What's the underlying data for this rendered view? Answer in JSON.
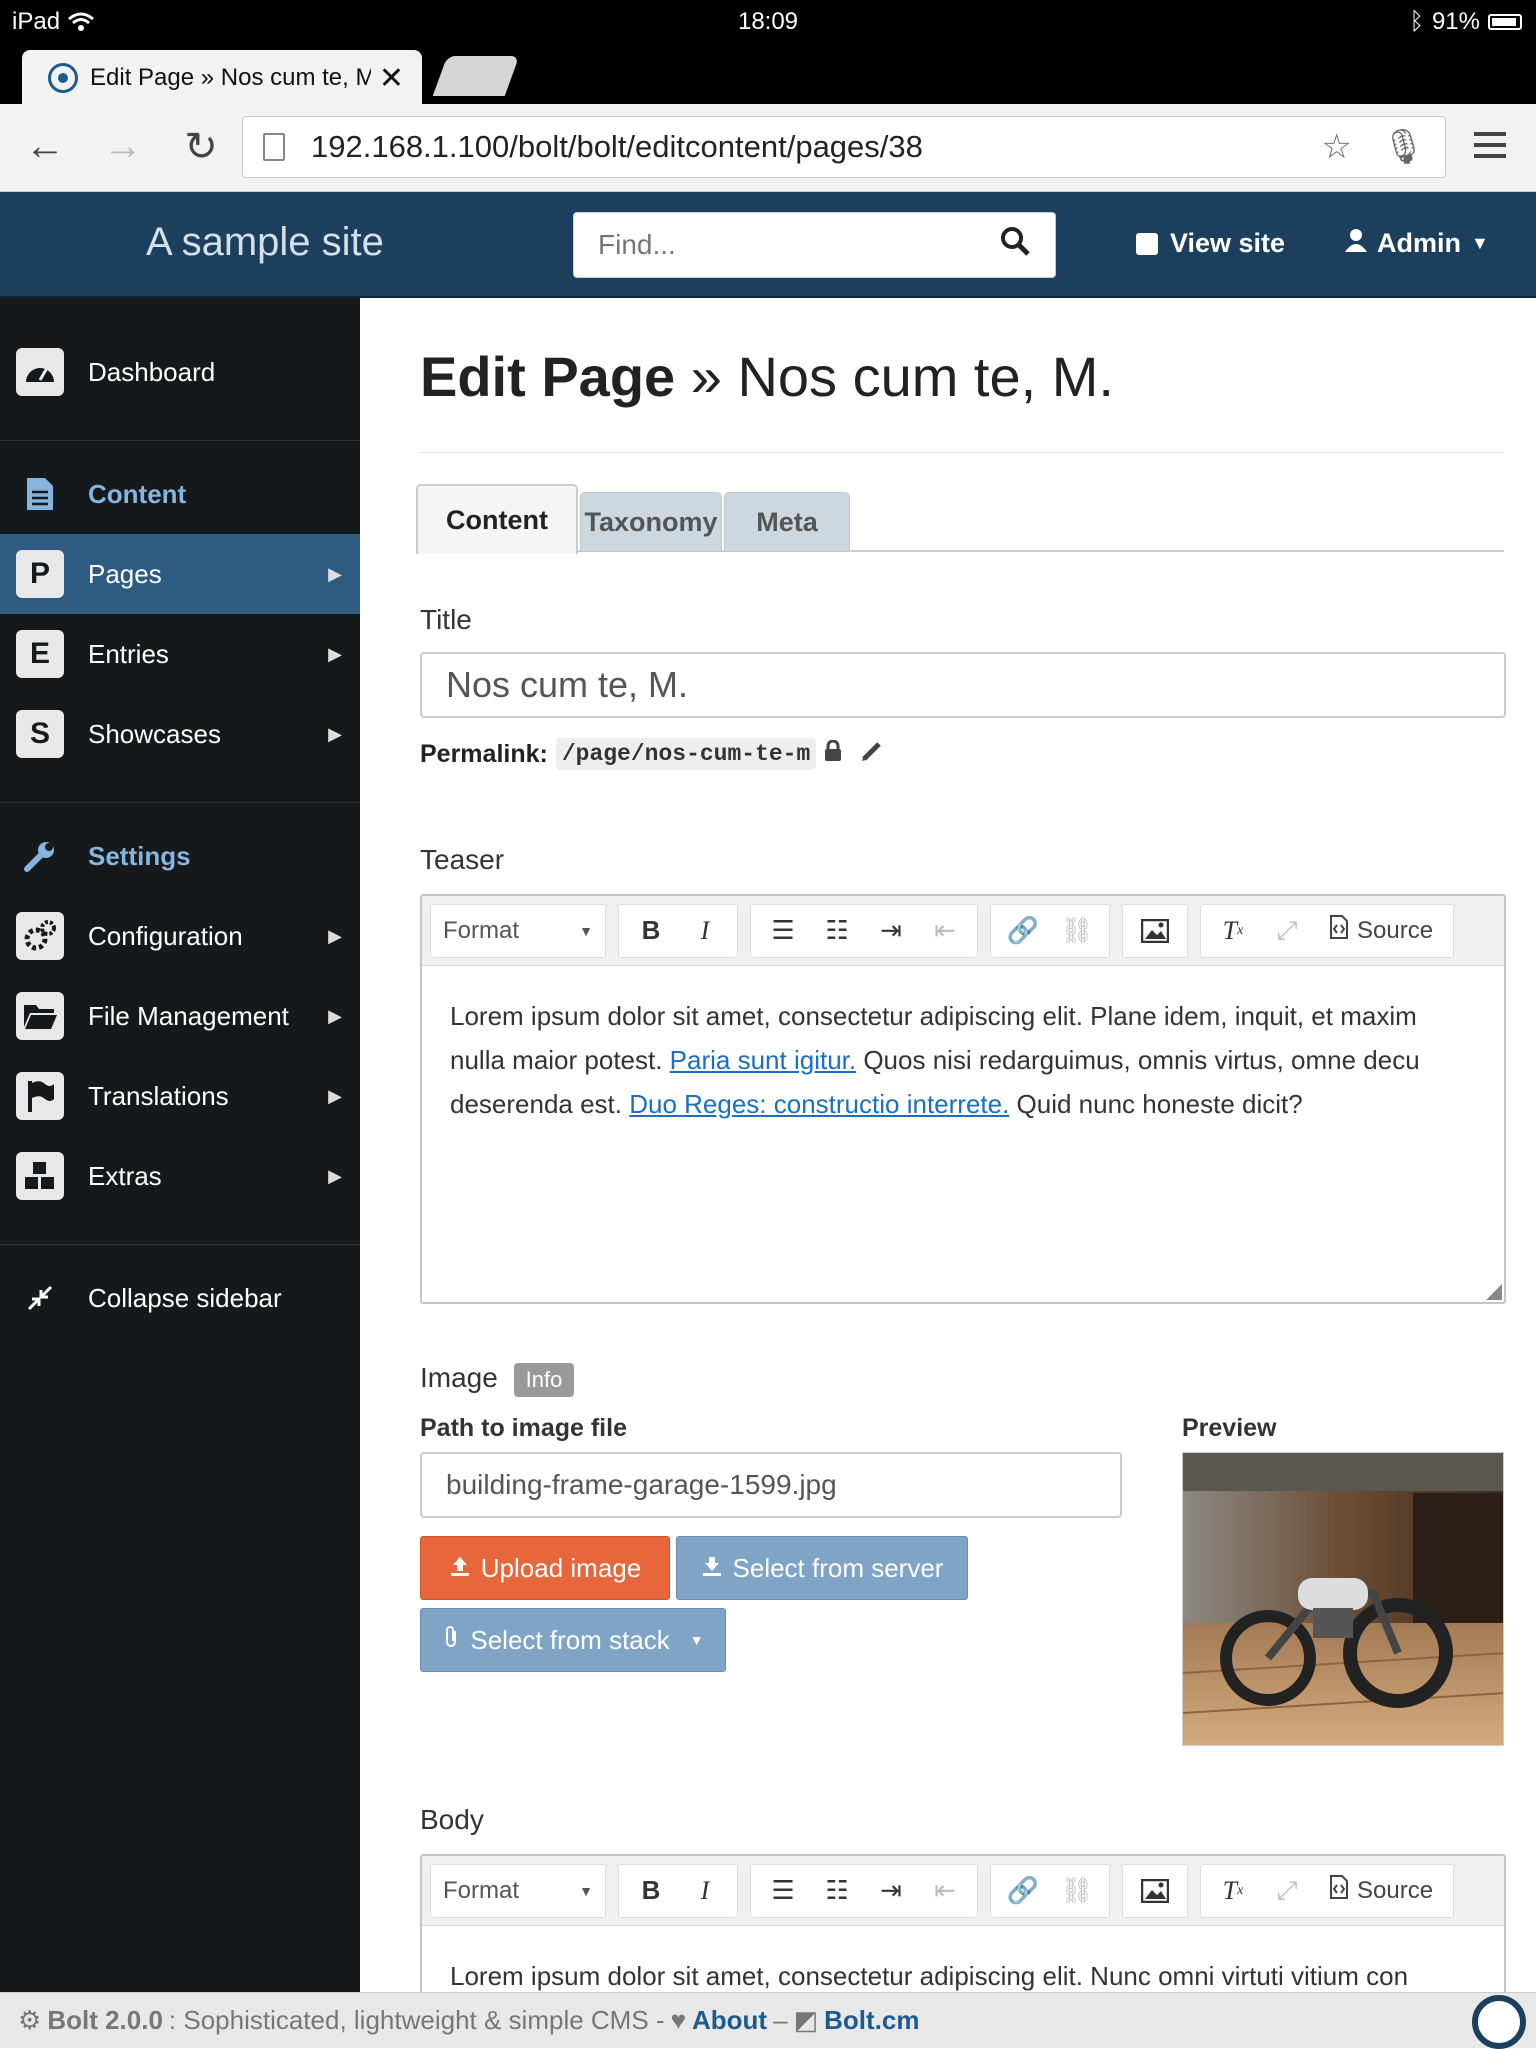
{
  "status_bar": {
    "device": "iPad",
    "time": "18:09",
    "battery": "91%"
  },
  "browser": {
    "tab_title": "Edit Page » Nos cum te, M",
    "url": "192.168.1.100/bolt/bolt/editcontent/pages/38"
  },
  "header": {
    "site_title": "A sample site",
    "search_placeholder": "Find...",
    "view_site": "View site",
    "admin": "Admin"
  },
  "sidebar": {
    "dashboard": "Dashboard",
    "content": "Content",
    "pages": "Pages",
    "entries": "Entries",
    "showcases": "Showcases",
    "settings": "Settings",
    "configuration": "Configuration",
    "file_management": "File Management",
    "translations": "Translations",
    "extras": "Extras",
    "collapse": "Collapse sidebar",
    "letters": {
      "pages": "P",
      "entries": "E",
      "showcases": "S"
    }
  },
  "page": {
    "heading_bold": "Edit Page",
    "heading_rest": "» Nos cum te, M.",
    "tabs": [
      "Content",
      "Taxonomy",
      "Meta"
    ],
    "title_label": "Title",
    "title_value": "Nos cum te, M.",
    "permalink_label": "Permalink:",
    "permalink_value": "/page/nos-cum-te-m",
    "teaser_label": "Teaser",
    "toolbar": {
      "format": "Format",
      "source": "Source"
    },
    "teaser_text": {
      "line1": "Lorem ipsum dolor sit amet, consectetur adipiscing elit. Plane idem, inquit, et maxim",
      "line2_pre": "nulla maior potest. ",
      "line2_link": "Paria sunt igitur.",
      "line2_post": " Quos nisi redarguimus, omnis virtus, omne decu",
      "line3_pre": "deserenda est. ",
      "line3_link": "Duo Reges: constructio interrete.",
      "line3_post": " Quid nunc honeste dicit?"
    },
    "image_label": "Image",
    "image_info": "Info",
    "path_label": "Path to image file",
    "path_value": "building-frame-garage-1599.jpg",
    "preview_label": "Preview",
    "upload_btn": "Upload image",
    "server_btn": "Select from server",
    "stack_btn": "Select from stack",
    "body_label": "Body",
    "body_text": "Lorem ipsum dolor sit amet, consectetur adipiscing elit. Nunc omni virtuti vitium con"
  },
  "footer": {
    "version": "Bolt 2.0.0",
    "tagline": ": Sophisticated, lightweight & simple CMS -",
    "about": "About",
    "dash": "–",
    "boltcm": "Bolt.cm"
  }
}
